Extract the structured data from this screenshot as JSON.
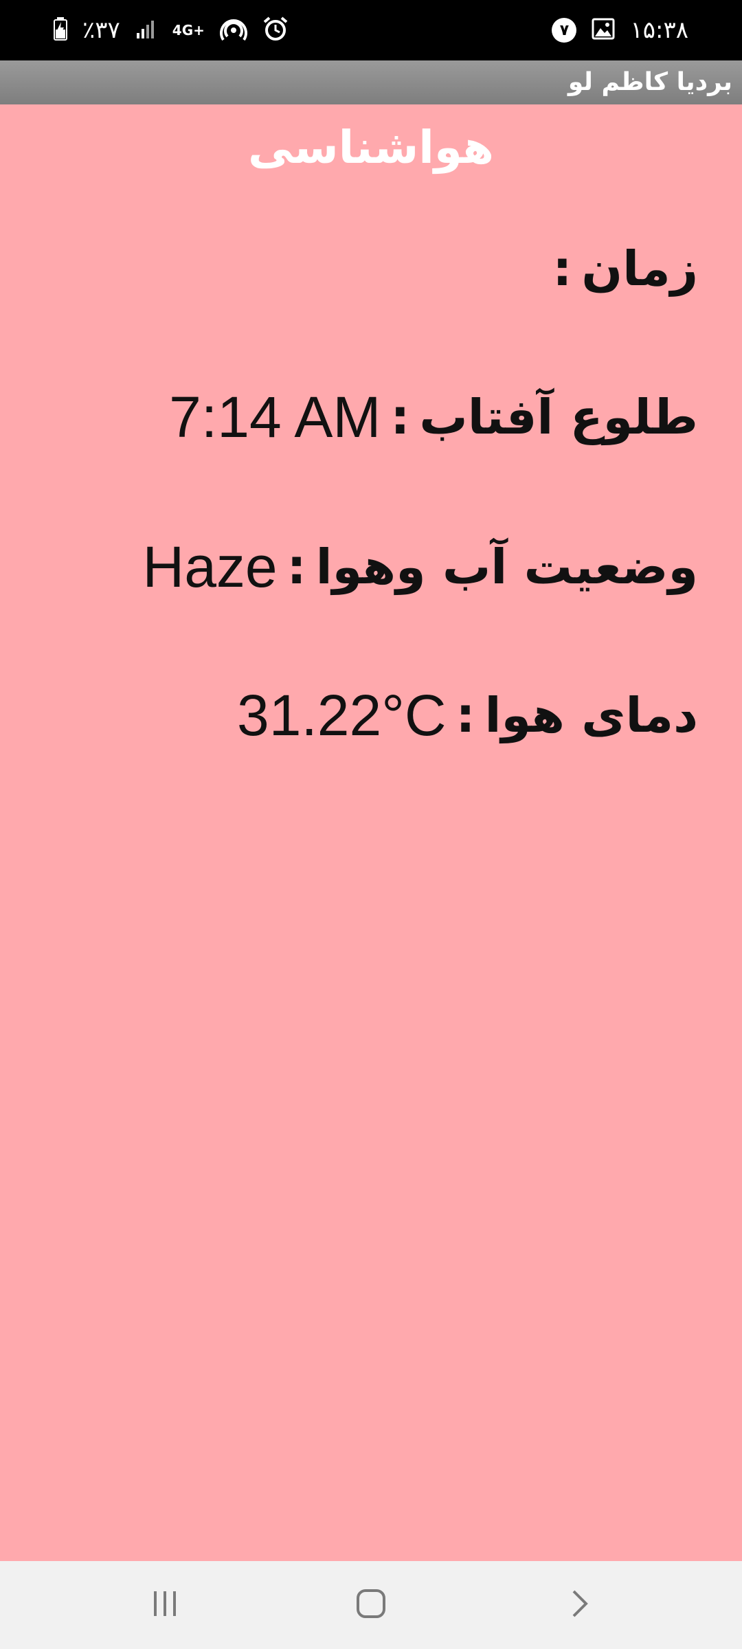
{
  "status_bar": {
    "time": "۱۵:۳۸",
    "notification_count": "۷",
    "battery": "٪۳۷",
    "network": "4G+",
    "icons": [
      "gallery-icon",
      "alarm-icon",
      "hotspot-icon",
      "signal-icon",
      "battery-charging-icon"
    ]
  },
  "app_bar": {
    "title": "بردیا کاظم لو"
  },
  "main": {
    "heading": "هواشناسی",
    "rows": [
      {
        "label": "زمان",
        "separator": ":",
        "value": ""
      },
      {
        "label": "طلوع آفتاب",
        "separator": ":",
        "value": "7:14 AM"
      },
      {
        "label": "وضعیت آب وهوا",
        "separator": ":",
        "value": "Haze"
      },
      {
        "label": "دمای هوا",
        "separator": ":",
        "value": "31.22°C"
      }
    ]
  },
  "nav_bar": {
    "icons": [
      "recent-apps-icon",
      "home-icon",
      "back-icon"
    ]
  },
  "colors": {
    "background": "#ffa9ad",
    "status_bar": "#000000",
    "app_bar": "#8a8a8a",
    "nav_bar": "#f1f1f1"
  }
}
